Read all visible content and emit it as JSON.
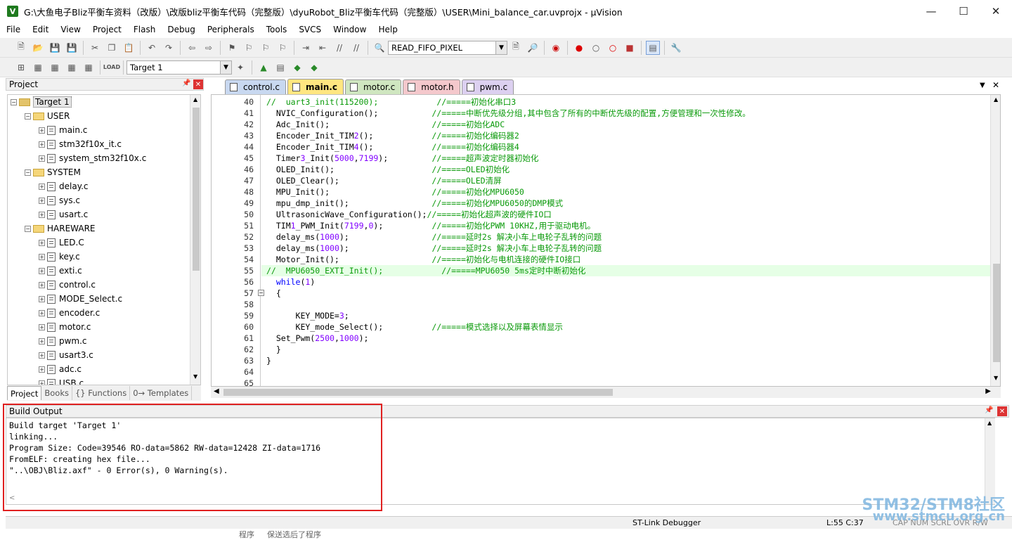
{
  "window": {
    "title": "G:\\大鱼电子Bliz平衡车资料（改版）\\改版bliz平衡车代码（完整版）\\dyuRobot_Bliz平衡车代码（完整版）\\USER\\Mini_balance_car.uvprojx - µVision",
    "icon": "V"
  },
  "menu": [
    "File",
    "Edit",
    "View",
    "Project",
    "Flash",
    "Debug",
    "Peripherals",
    "Tools",
    "SVCS",
    "Window",
    "Help"
  ],
  "toolbar": {
    "find_combo": "READ_FIFO_PIXEL",
    "target_combo": "Target 1"
  },
  "project_panel": {
    "title": "Project",
    "tree": [
      {
        "label": "Target 1",
        "level": 0,
        "type": "target"
      },
      {
        "label": "USER",
        "level": 1,
        "type": "folder"
      },
      {
        "label": "main.c",
        "level": 2,
        "type": "file"
      },
      {
        "label": "stm32f10x_it.c",
        "level": 2,
        "type": "file"
      },
      {
        "label": "system_stm32f10x.c",
        "level": 2,
        "type": "file"
      },
      {
        "label": "SYSTEM",
        "level": 1,
        "type": "folder"
      },
      {
        "label": "delay.c",
        "level": 2,
        "type": "file"
      },
      {
        "label": "sys.c",
        "level": 2,
        "type": "file"
      },
      {
        "label": "usart.c",
        "level": 2,
        "type": "file"
      },
      {
        "label": "HAREWARE",
        "level": 1,
        "type": "folder"
      },
      {
        "label": "LED.C",
        "level": 2,
        "type": "file"
      },
      {
        "label": "key.c",
        "level": 2,
        "type": "file"
      },
      {
        "label": "exti.c",
        "level": 2,
        "type": "file"
      },
      {
        "label": "control.c",
        "level": 2,
        "type": "file"
      },
      {
        "label": "MODE_Select.c",
        "level": 2,
        "type": "file"
      },
      {
        "label": "encoder.c",
        "level": 2,
        "type": "file"
      },
      {
        "label": "motor.c",
        "level": 2,
        "type": "file"
      },
      {
        "label": "pwm.c",
        "level": 2,
        "type": "file"
      },
      {
        "label": "usart3.c",
        "level": 2,
        "type": "file"
      },
      {
        "label": "adc.c",
        "level": 2,
        "type": "file"
      },
      {
        "label": "USB.c",
        "level": 2,
        "type": "file"
      }
    ],
    "tabs": [
      "Project",
      "Books",
      "{} Functions",
      "0→ Templates"
    ]
  },
  "editor": {
    "tabs": [
      {
        "label": "control.c",
        "color": "#c8d8f0"
      },
      {
        "label": "main.c",
        "color": "#ffe680",
        "active": true
      },
      {
        "label": "motor.c",
        "color": "#cfe6c0"
      },
      {
        "label": "motor.h",
        "color": "#f4c8cc"
      },
      {
        "label": "pwm.c",
        "color": "#dcd0f0"
      }
    ],
    "lines": [
      {
        "n": "40",
        "t": "//  uart3_init(115200);            //=====初始化串口3",
        "k": "cmt"
      },
      {
        "n": "41",
        "t": "  NVIC_Configuration();           //=====中断优先级分组,其中包含了所有的中断优先级的配置,方便管理和一次性修改。",
        "k": "code"
      },
      {
        "n": "42",
        "t": "  Adc_Init();                     //=====初始化ADC",
        "k": "code"
      },
      {
        "n": "43",
        "t": "  Encoder_Init_TIM2();            //=====初始化编码器2",
        "k": "code"
      },
      {
        "n": "44",
        "t": "  Encoder_Init_TIM4();            //=====初始化编码器4",
        "k": "code"
      },
      {
        "n": "45",
        "t": "  Timer3_Init(5000,7199);         //=====超声波定时器初始化",
        "k": "code"
      },
      {
        "n": "46",
        "t": "  OLED_Init();                    //=====OLED初始化",
        "k": "code"
      },
      {
        "n": "47",
        "t": "  OLED_Clear();                   //=====OLED清屏",
        "k": "code"
      },
      {
        "n": "48",
        "t": "  MPU_Init();                     //=====初始化MPU6050",
        "k": "code"
      },
      {
        "n": "49",
        "t": "  mpu_dmp_init();                 //=====初始化MPU6050的DMP模式",
        "k": "code"
      },
      {
        "n": "50",
        "t": "  UltrasonicWave_Configuration();//=====初始化超声波的硬件IO口",
        "k": "code"
      },
      {
        "n": "51",
        "t": "  TIM1_PWM_Init(7199,0);          //=====初始化PWM 10KHZ,用于驱动电机。",
        "k": "code"
      },
      {
        "n": "52",
        "t": "  delay_ms(1000);                 //=====延时2s 解决小车上电轮子乱转的问题",
        "k": "code"
      },
      {
        "n": "53",
        "t": "  delay_ms(1000);                 //=====延时2s 解决小车上电轮子乱转的问题",
        "k": "code"
      },
      {
        "n": "54",
        "t": "  Motor_Init();                   //=====初始化与电机连接的硬件IO接口",
        "k": "code"
      },
      {
        "n": "55",
        "t": "//  MPU6050_EXTI_Init();            //=====MPU6050 5ms定时中断初始化",
        "k": "cmt"
      },
      {
        "n": "56",
        "t": "  while(1)",
        "k": "kw"
      },
      {
        "n": "57",
        "t": "  {",
        "k": "plain"
      },
      {
        "n": "58",
        "t": "",
        "k": "plain"
      },
      {
        "n": "59",
        "t": "      KEY_MODE=3;",
        "k": "plain"
      },
      {
        "n": "60",
        "t": "      KEY_mode_Select();          //=====模式选择以及屏幕表情显示",
        "k": "code"
      },
      {
        "n": "61",
        "t": "  Set_Pwm(2500,1000);",
        "k": "plain"
      },
      {
        "n": "62",
        "t": "  }",
        "k": "plain"
      },
      {
        "n": "63",
        "t": "}",
        "k": "plain"
      },
      {
        "n": "64",
        "t": "",
        "k": "plain"
      },
      {
        "n": "65",
        "t": "",
        "k": "plain"
      }
    ]
  },
  "build_output": {
    "title": "Build Output",
    "lines": [
      "Build target 'Target 1'",
      "linking...",
      "Program Size: Code=39546 RO-data=5862 RW-data=12428 ZI-data=1716",
      "FromELF: creating hex file...",
      "\"..\\OBJ\\Bliz.axf\" - 0 Error(s), 0 Warning(s)."
    ]
  },
  "status": {
    "debugger": "ST-Link Debugger",
    "position": "L:55 C:37",
    "indicators": "CAP  NUM  SCRL  OVR  R/W"
  },
  "watermark": {
    "line1": "STM32/STM8社区",
    "line2": "www.stmcu.org.cn"
  },
  "below_text": "程序 　 保送选后了程序"
}
